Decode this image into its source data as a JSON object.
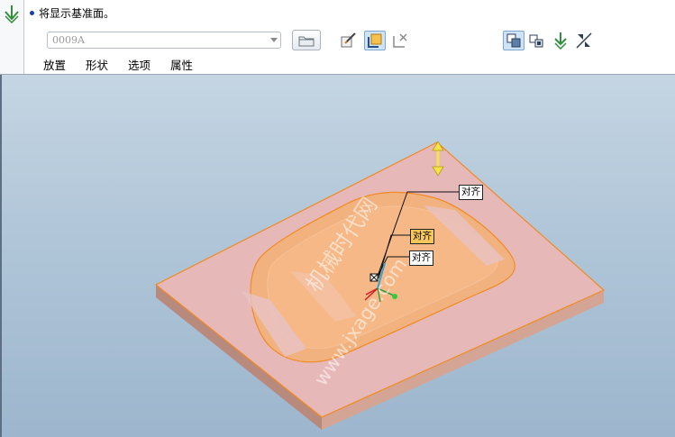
{
  "message": {
    "text": "将显示基准面。"
  },
  "reference_dropdown": {
    "value": "0009A"
  },
  "tabs": [
    "放置",
    "形状",
    "选项",
    "属性"
  ],
  "icons": {
    "feature": "extrude-feature-icon",
    "folder": "folder-icon",
    "sketch": "sketch-icon",
    "plane_reference": "plane-reference-icon",
    "remove_reference": "remove-reference-icon",
    "solid": "solid-icon",
    "surface": "surface-icon",
    "flip": "flip-direction-icon",
    "remove_material": "remove-material-icon"
  },
  "callouts": [
    "对齐",
    "对齐",
    "对齐"
  ],
  "watermark": {
    "line1": "机械时代网",
    "line2": "www.jxage.com"
  },
  "colors": {
    "plate_top": "#e6b9b8",
    "plate_side": "#c89a8d",
    "pocket": "#f2b27f",
    "edge_highlight": "#f08a23",
    "viewport_top": "#c5d5e3",
    "viewport_bottom": "#9db6cd",
    "arrow": "#f7e24a"
  }
}
